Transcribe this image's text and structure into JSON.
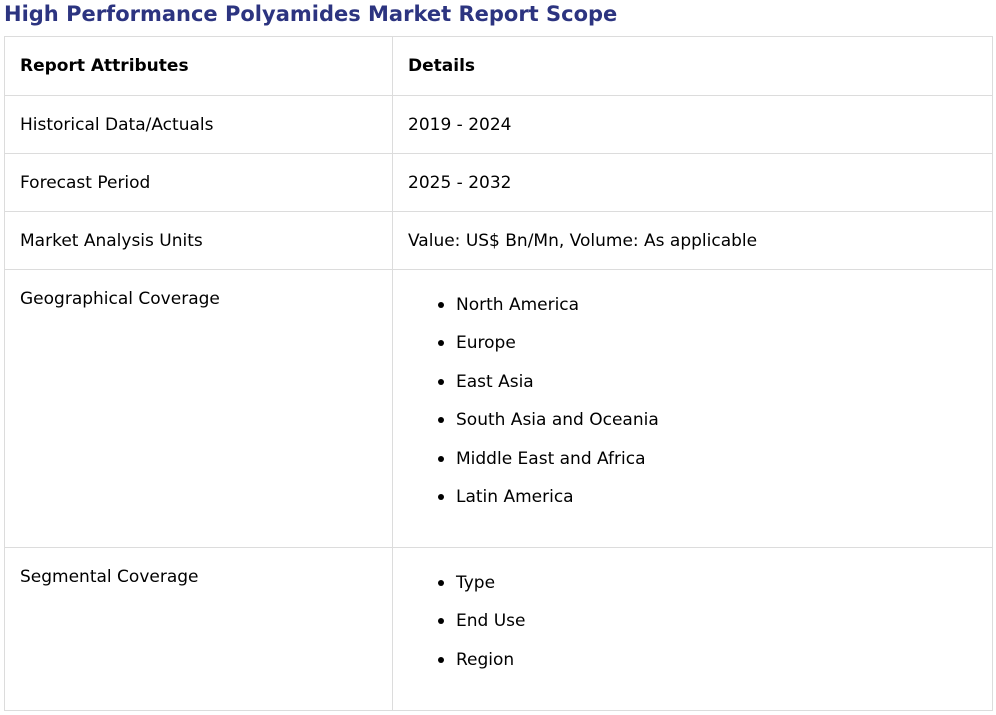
{
  "title": "High Performance Polyamides Market Report Scope",
  "table": {
    "headers": {
      "attribute": "Report Attributes",
      "details": "Details"
    },
    "rows": [
      {
        "attribute": "Historical Data/Actuals",
        "details": "2019 - 2024"
      },
      {
        "attribute": "Forecast Period",
        "details": "2025 - 2032"
      },
      {
        "attribute": "Market Analysis Units",
        "details": "Value: US$ Bn/Mn, Volume: As applicable"
      }
    ],
    "geographical": {
      "attribute": "Geographical Coverage",
      "items": [
        "North America",
        "Europe",
        "East Asia",
        "South Asia and Oceania",
        "Middle East and Africa",
        "Latin America"
      ]
    },
    "segmental": {
      "attribute": "Segmental Coverage",
      "items": [
        "Type",
        "End Use",
        "Region"
      ]
    }
  },
  "colors": {
    "title": "#2c3480",
    "border": "#dcdcdc"
  }
}
